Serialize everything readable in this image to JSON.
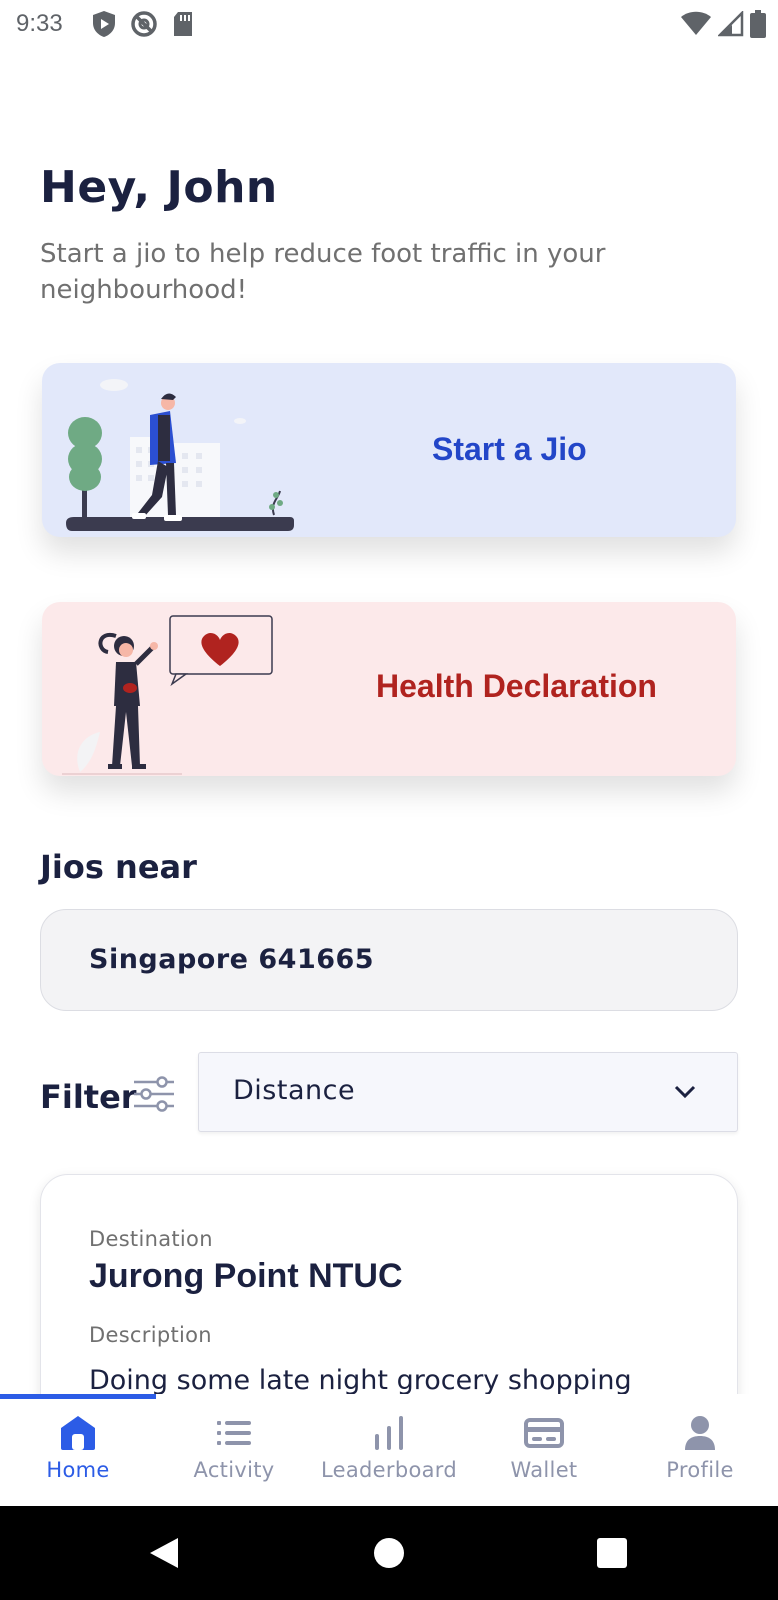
{
  "status_bar": {
    "time": "9:33",
    "left_icons": [
      "shield-play-icon",
      "no-sign-icon",
      "sd-card-icon"
    ],
    "right_icons": [
      "wifi-icon",
      "cell-signal-icon",
      "battery-icon"
    ]
  },
  "header": {
    "greeting": "Hey, John",
    "subtitle": "Start a jio to help reduce foot traffic in your neighbourhood!"
  },
  "cards": {
    "start_jio": {
      "label": "Start a Jio",
      "background": "#e2e8fa",
      "text_color": "#2346c8"
    },
    "health_declaration": {
      "label": "Health Declaration",
      "background": "#fce9ea",
      "text_color": "#b0231f"
    }
  },
  "jios_near": {
    "title": "Jios near",
    "location_value": "Singapore 641665"
  },
  "filter": {
    "label": "Filter",
    "selected": "Distance"
  },
  "jio_listing": {
    "destination_label": "Destination",
    "destination": "Jurong Point NTUC",
    "description_label": "Description",
    "description": "Doing some late night grocery shopping"
  },
  "bottom_nav": {
    "active_color": "#2c5ce6",
    "inactive_color": "#8e94ab",
    "items": [
      {
        "label": "Home",
        "icon": "home-icon",
        "active": true
      },
      {
        "label": "Activity",
        "icon": "list-icon",
        "active": false
      },
      {
        "label": "Leaderboard",
        "icon": "bar-chart-icon",
        "active": false
      },
      {
        "label": "Wallet",
        "icon": "wallet-card-icon",
        "active": false
      },
      {
        "label": "Profile",
        "icon": "person-icon",
        "active": false
      }
    ]
  },
  "android_nav": [
    "back-icon",
    "home-circle-icon",
    "recents-icon"
  ]
}
